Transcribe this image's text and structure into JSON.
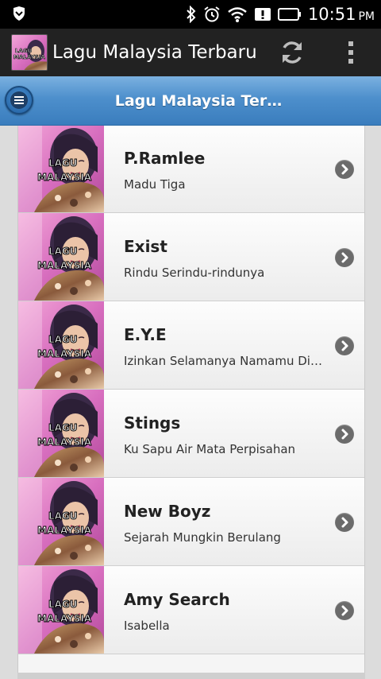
{
  "status_bar": {
    "time": "10:51",
    "ampm": "PM"
  },
  "action_bar": {
    "title": "Lagu Malaysia Terbaru"
  },
  "header": {
    "title": "Lagu Malaysia Ter…"
  },
  "thumbnail": {
    "line1": "LAGU",
    "line2": "MALAYSIA"
  },
  "songs": [
    {
      "artist": "",
      "song": ""
    },
    {
      "artist": "P.Ramlee",
      "song": "Madu Tiga"
    },
    {
      "artist": "Exist",
      "song": "Rindu Serindu-rindunya"
    },
    {
      "artist": "E.Y.E",
      "song": "Izinkan Selamanya Namamu Dihatiku"
    },
    {
      "artist": "Stings",
      "song": "Ku Sapu Air Mata Perpisahan"
    },
    {
      "artist": "New Boyz",
      "song": "Sejarah Mungkin Berulang"
    },
    {
      "artist": "Amy Search",
      "song": "Isabella"
    }
  ],
  "colors": {
    "header_blue": "#4d8fcc",
    "action_bar": "#222222",
    "chevron": "#6b6b6b"
  }
}
